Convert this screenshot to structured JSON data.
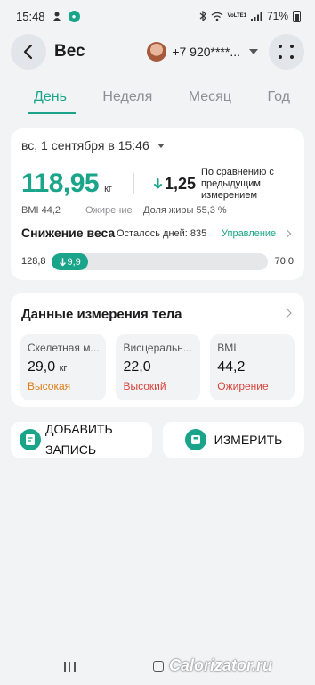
{
  "status_bar": {
    "time": "15:48",
    "network": "VoLTE1",
    "battery": "71%"
  },
  "header": {
    "title": "Вес",
    "account_phone": "+7 920****..."
  },
  "tabs": [
    {
      "label": "День",
      "active": true
    },
    {
      "label": "Неделя",
      "active": false
    },
    {
      "label": "Месяц",
      "active": false
    },
    {
      "label": "Год",
      "active": false
    }
  ],
  "measurement": {
    "datetime": "вс, 1 сентября в 15:46",
    "weight": "118,95",
    "weight_unit": "кг",
    "delta_value": "1,25",
    "delta_direction": "down",
    "compare_text": "По сравнению с предыдущим измерением",
    "bmi": "BMI 44,2",
    "bmi_category": "Ожирение",
    "body_fat": "Доля жиры 55,3 %"
  },
  "weight_loss": {
    "title": "Снижение веса",
    "days_left": "Осталось дней: 835",
    "manage_link": "Управление",
    "start_weight": "128,8",
    "goal_weight": "70,0",
    "lost_label": "9,9",
    "progress_fraction": 0.17
  },
  "body_data": {
    "title": "Данные измерения тела",
    "tiles": [
      {
        "label": "Скелетная м...",
        "value": "29,0",
        "unit": "кг",
        "status": "Высокая",
        "status_color": "#e07b14"
      },
      {
        "label": "Висцеральн...",
        "value": "22,0",
        "unit": "",
        "status": "Высокий",
        "status_color": "#d9443c"
      },
      {
        "label": "BMI",
        "value": "44,2",
        "unit": "",
        "status": "Ожирение",
        "status_color": "#d9443c"
      }
    ]
  },
  "actions": {
    "add_record": "ДОБАВИТЬ ЗАПИСЬ",
    "measure": "ИЗМЕРИТЬ"
  },
  "watermark": "Calorizator.ru",
  "colors": {
    "accent": "#1aa58a",
    "background": "#f1f3f5"
  }
}
